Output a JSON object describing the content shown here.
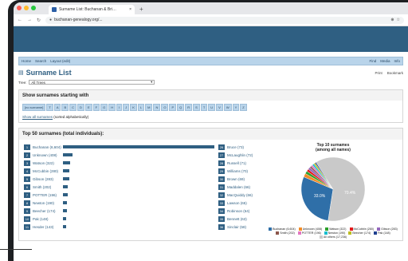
{
  "browser": {
    "tab_title": "Surname List: Buchanan & Bri…",
    "url": "buchanan-genealogy.org/..."
  },
  "menu": {
    "left": [
      "Home",
      "Search",
      "Layout (edit)"
    ],
    "right": [
      "Find",
      "Media",
      "Info"
    ]
  },
  "page": {
    "title": "Surname List",
    "print_label": "Print",
    "bookmark_label": "Bookmark",
    "tree_label": "Tree:",
    "tree_value": "All Trees"
  },
  "starting": {
    "header": "Show surnames starting with",
    "no_surname": "[no surname]",
    "letters": [
      "T",
      "A",
      "B",
      "C",
      "D",
      "E",
      "F",
      "G",
      "H",
      "I",
      "J",
      "K",
      "L",
      "M",
      "N",
      "O",
      "P",
      "Q",
      "R",
      "S",
      "T",
      "U",
      "V",
      "W",
      "Y",
      "Z"
    ],
    "show_all_link": "Show all surnames",
    "show_all_suffix": " (sorted alphabetically)"
  },
  "top50": {
    "header": "Top 50 surnames (total individuals):",
    "left": [
      {
        "rank": "1",
        "name": "Buchanan (6,604)",
        "value": 6604
      },
      {
        "rank": "2",
        "name": "Unknown (408)",
        "value": 408
      },
      {
        "rank": "3",
        "name": "Watson (322)",
        "value": 322
      },
      {
        "rank": "4",
        "name": "McCubbin (280)",
        "value": 280
      },
      {
        "rank": "5",
        "name": "Gibson (283)",
        "value": 283
      },
      {
        "rank": "6",
        "name": "Smith (202)",
        "value": 202
      },
      {
        "rank": "7",
        "name": "POTTER (196)",
        "value": 196
      },
      {
        "rank": "8",
        "name": "Newton (190)",
        "value": 190
      },
      {
        "rank": "9",
        "name": "Beecher (174)",
        "value": 174
      },
      {
        "rank": "10",
        "name": "Pak (148)",
        "value": 148
      },
      {
        "rank": "11",
        "name": "Hesder (143)",
        "value": 143
      }
    ],
    "right": [
      {
        "rank": "26",
        "name": "Bruce (73)"
      },
      {
        "rank": "27",
        "name": "McLaughlin (72)"
      },
      {
        "rank": "28",
        "name": "Russell (71)"
      },
      {
        "rank": "29",
        "name": "Williams (70)"
      },
      {
        "rank": "30",
        "name": "Brown (69)"
      },
      {
        "rank": "31",
        "name": "Maddalen (66)"
      },
      {
        "rank": "32",
        "name": "MacQuiddy (66)"
      },
      {
        "rank": "33",
        "name": "Lawson (65)"
      },
      {
        "rank": "34",
        "name": "Robinson (64)"
      },
      {
        "rank": "35",
        "name": "Bennett (63)"
      },
      {
        "rank": "36",
        "name": "Sinclair (58)"
      }
    ]
  },
  "pie": {
    "title_line1": "Top 10 surnames",
    "title_line2": "(among all names)",
    "big_label": "70.4%",
    "small_label": "33.0%",
    "slices": [
      {
        "name": "Buchanan (6,604)",
        "value": 33.0,
        "color": "#2f6fa8"
      },
      {
        "name": "Unknown (408)",
        "value": 2.1,
        "color": "#f28c28"
      },
      {
        "name": "Watson (322)",
        "value": 1.6,
        "color": "#2ca02c"
      },
      {
        "name": "McCubbin (280)",
        "value": 1.4,
        "color": "#e41a1c"
      },
      {
        "name": "Gibson (283)",
        "value": 1.4,
        "color": "#9467bd"
      },
      {
        "name": "Smith (202)",
        "value": 1.0,
        "color": "#8c564b"
      },
      {
        "name": "POTTER (196)",
        "value": 1.0,
        "color": "#e377c2"
      },
      {
        "name": "Newton (190)",
        "value": 1.0,
        "color": "#17becf"
      },
      {
        "name": "Beecher (174)",
        "value": 0.9,
        "color": "#bcbd22"
      },
      {
        "name": "Pak (148)",
        "value": 0.7,
        "color": "#1f3f8f"
      },
      {
        "name": "All others (17,236)",
        "value": 70.4,
        "color": "#c9c9c9"
      }
    ]
  },
  "colors": {
    "banner": "#2f5f82",
    "accent": "#2f5f82",
    "chip": "#b9d4ea"
  }
}
